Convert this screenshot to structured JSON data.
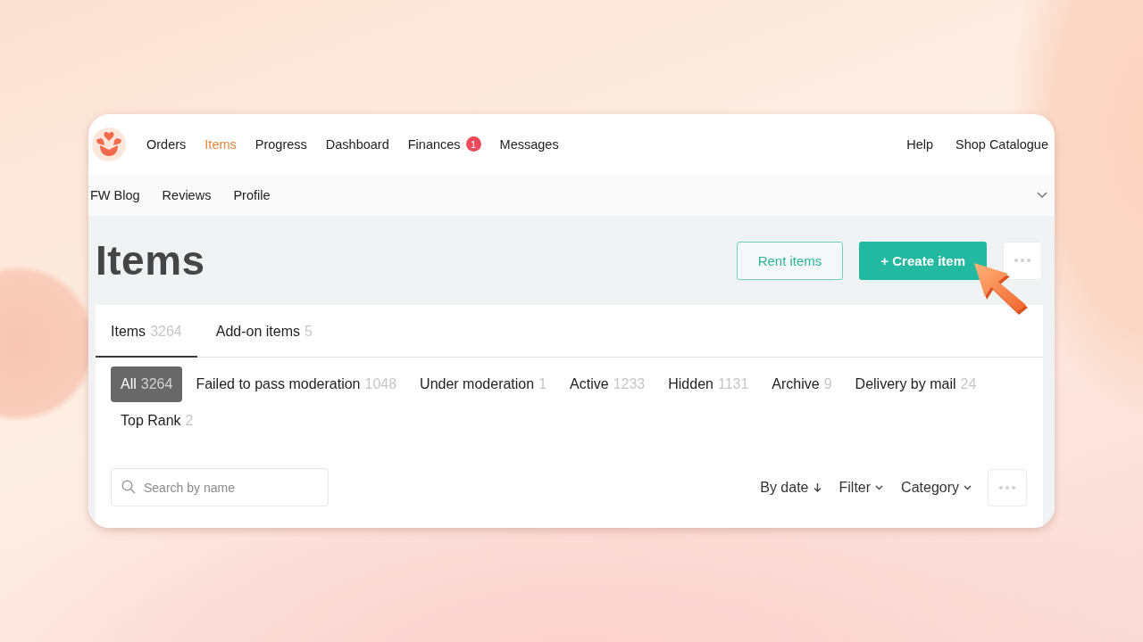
{
  "nav": {
    "primary": [
      {
        "label": "Orders",
        "selected": false
      },
      {
        "label": "Items",
        "selected": true
      },
      {
        "label": "Progress",
        "selected": false
      },
      {
        "label": "Dashboard",
        "selected": false
      },
      {
        "label": "Finances",
        "selected": false,
        "badge": "1"
      },
      {
        "label": "Messages",
        "selected": false
      }
    ],
    "utility": [
      {
        "label": "Help"
      },
      {
        "label": "Shop Catalogue"
      }
    ],
    "secondary": [
      {
        "label": "FW Blog",
        "selected": false
      },
      {
        "label": "Reviews",
        "selected": false
      },
      {
        "label": "Profile",
        "selected": false
      }
    ]
  },
  "page": {
    "title": "Items",
    "actions": [
      {
        "kind": "outline",
        "label": "Rent items"
      },
      {
        "kind": "primary",
        "label": "+ Create item"
      },
      {
        "kind": "more"
      }
    ]
  },
  "tabs": [
    {
      "label": "Items",
      "count": "3264",
      "selected": true
    },
    {
      "label": "Add-on items",
      "count": "5",
      "selected": false
    }
  ],
  "filters": [
    {
      "label": "All",
      "count": "3264",
      "selected": true
    },
    {
      "label": "Failed to pass moderation",
      "count": "1048",
      "selected": false
    },
    {
      "label": "Under moderation",
      "count": "1",
      "selected": false
    },
    {
      "label": "Active",
      "count": "1233",
      "selected": false
    },
    {
      "label": "Hidden",
      "count": "1131",
      "selected": false
    },
    {
      "label": "Archive",
      "count": "9",
      "selected": false
    },
    {
      "label": "Delivery by mail",
      "count": "24",
      "selected": false
    },
    {
      "label": "Top Rank",
      "count": "2",
      "selected": false
    }
  ],
  "toolbar": {
    "search": {
      "placeholder": "Search by name"
    },
    "sorts": [
      {
        "kind": "sort",
        "label": "By date"
      },
      {
        "kind": "dropdown",
        "label": "Filter"
      },
      {
        "kind": "dropdown",
        "label": "Category"
      }
    ],
    "more": true
  }
}
